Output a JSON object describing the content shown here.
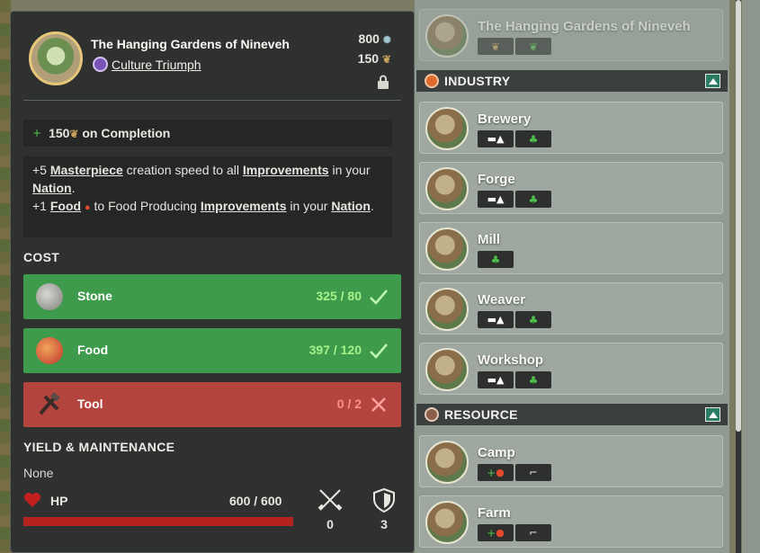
{
  "tooltip": {
    "title": "The Hanging Gardens of Nineveh",
    "category": "Culture Triumph",
    "production_cost": "800",
    "influence_value": "150",
    "completion_reward": "150",
    "completion_suffix": "on Completion",
    "effects": {
      "line1_a": "+5 ",
      "line1_b": "Masterpiece",
      "line1_c": " creation speed to all ",
      "line1_d": "Improvements",
      "line1_e": " in your ",
      "line1_f": "Nation",
      "line1_g": ".",
      "line2_a": "+1 ",
      "line2_b": "Food",
      "line2_c": " to Food Producing ",
      "line2_d": "Improvements",
      "line2_e": " in your ",
      "line2_f": "Nation",
      "line2_g": "."
    },
    "cost_heading": "COST",
    "costs": [
      {
        "name": "Stone",
        "amount": "325 / 80",
        "met": true
      },
      {
        "name": "Food",
        "amount": "397 / 120",
        "met": true
      },
      {
        "name": "Tool",
        "amount": "0 / 2",
        "met": false
      }
    ],
    "yield_heading": "YIELD & MAINTENANCE",
    "yield_value": "None",
    "hp_label": "HP",
    "hp_value": "600 / 600",
    "hp_fraction": 1.0,
    "attack_value": "0",
    "defense_value": "3"
  },
  "list": {
    "top_item": "The Hanging Gardens of Nineveh",
    "sections": [
      {
        "title": "INDUSTRY",
        "items": [
          "Brewery",
          "Forge",
          "Mill",
          "Weaver",
          "Workshop"
        ]
      },
      {
        "title": "RESOURCE",
        "items": [
          "Camp",
          "Farm"
        ]
      }
    ]
  },
  "colors": {
    "met": "#3e9b4b",
    "unmet": "#b4443e",
    "panel": "#2e3130",
    "accent_leaf": "#4fc14b"
  }
}
